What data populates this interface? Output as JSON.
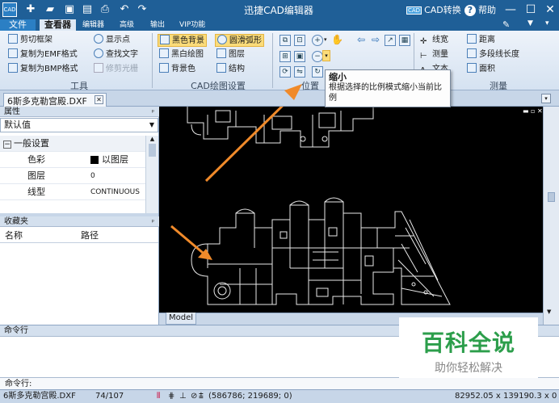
{
  "window": {
    "title": "迅捷CAD编辑器",
    "cad_convert": "CAD转换",
    "cad_badge": "CAD",
    "help": "帮助",
    "app_icon": "CAD"
  },
  "quick_access": [
    "new-file-icon",
    "open-folder-icon",
    "save-icon",
    "save-as-icon",
    "print-icon",
    "undo-icon",
    "redo-icon"
  ],
  "menu_tabs": [
    {
      "label": "文件",
      "kind": "file"
    },
    {
      "label": "查看器",
      "kind": "active"
    },
    {
      "label": "编辑器",
      "kind": ""
    },
    {
      "label": "高级",
      "kind": ""
    },
    {
      "label": "输出",
      "kind": ""
    },
    {
      "label": "VIP功能",
      "kind": ""
    }
  ],
  "ribbon": {
    "tools": {
      "label": "工具",
      "items": [
        "剪切框架",
        "复制为EMF格式",
        "复制为BMP格式",
        "显示点",
        "查找文字",
        "修剪光栅"
      ]
    },
    "cad_settings": {
      "label": "CAD绘图设置",
      "items": [
        "黑色背景",
        "黑白绘图",
        "背景色",
        "圆滑弧形",
        "图层",
        "结构"
      ]
    },
    "position": {
      "label": "位置"
    },
    "measure": {
      "label": "测量",
      "items": [
        "线宽",
        "测量",
        "文本",
        "距离",
        "多段线长度",
        "面积"
      ]
    }
  },
  "tooltip": {
    "title": "缩小",
    "body": "根据选择的比例模式缩小当前比例"
  },
  "document_tab": {
    "label": "6斯多克勒宫殿.DXF"
  },
  "properties_panel": {
    "header": "属性",
    "dropdown_value": "默认值",
    "section": "一般设置",
    "rows": [
      {
        "name": "色彩",
        "value": "以图层"
      },
      {
        "name": "图层",
        "value": "0"
      },
      {
        "name": "线型",
        "value": "CONTINUOUS"
      }
    ]
  },
  "favorites_panel": {
    "header": "收藏夹",
    "col_name": "名称",
    "col_path": "路径"
  },
  "model_tab": "Model",
  "command": {
    "header": "命令行",
    "prompt": "命令行:"
  },
  "status": {
    "file": "6斯多克勒宫殿.DXF",
    "pages": "74/107",
    "coords": "(586786; 219689; 0)",
    "dims": "82952.05 x 139190.3 x 0"
  },
  "watermark": {
    "main": "百科全说",
    "sub": "助你轻松解决"
  },
  "colors": {
    "title_bar": "#1f5f97",
    "canvas": "#000000",
    "accent_arrow": "#f08a2a",
    "watermark_green": "#2c9e4b"
  }
}
